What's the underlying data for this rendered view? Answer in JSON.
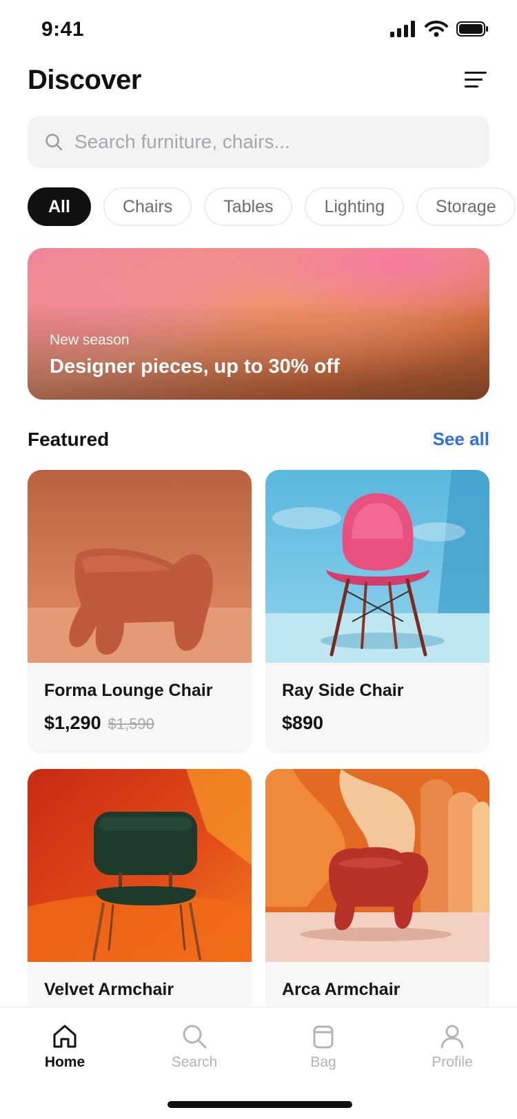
{
  "status_bar": {
    "time": "9:41"
  },
  "header": {
    "title": "Discover",
    "menu_icon": "menu-icon"
  },
  "search": {
    "placeholder": "Search furniture, chairs...",
    "value": ""
  },
  "categories": [
    {
      "label": "All",
      "active": true
    },
    {
      "label": "Chairs",
      "active": false
    },
    {
      "label": "Tables",
      "active": false
    },
    {
      "label": "Lighting",
      "active": false
    },
    {
      "label": "Storage",
      "active": false
    }
  ],
  "promo": {
    "eyebrow": "New season",
    "title": "Designer pieces, up to 30% off"
  },
  "featured": {
    "title": "Featured",
    "see_all": "See all",
    "products": [
      {
        "name": "Forma Lounge Chair",
        "price": "$1,290",
        "old_price": "$1,590"
      },
      {
        "name": "Ray Side Chair",
        "price": "$890",
        "old_price": ""
      },
      {
        "name": "Velvet Armchair",
        "price": "",
        "old_price": ""
      },
      {
        "name": "Arca Armchair",
        "price": "",
        "old_price": ""
      }
    ]
  },
  "tab_bar": {
    "tabs": [
      {
        "label": "Home",
        "icon": "home-icon",
        "active": true
      },
      {
        "label": "Search",
        "icon": "search-icon",
        "active": false
      },
      {
        "label": "Bag",
        "icon": "bag-icon",
        "active": false
      },
      {
        "label": "Profile",
        "icon": "profile-icon",
        "active": false
      }
    ]
  },
  "colors": {
    "accent": "#2f6fe4",
    "chip_active": "#111111",
    "text_primary": "#111111",
    "text_muted": "#a7a7ac"
  }
}
